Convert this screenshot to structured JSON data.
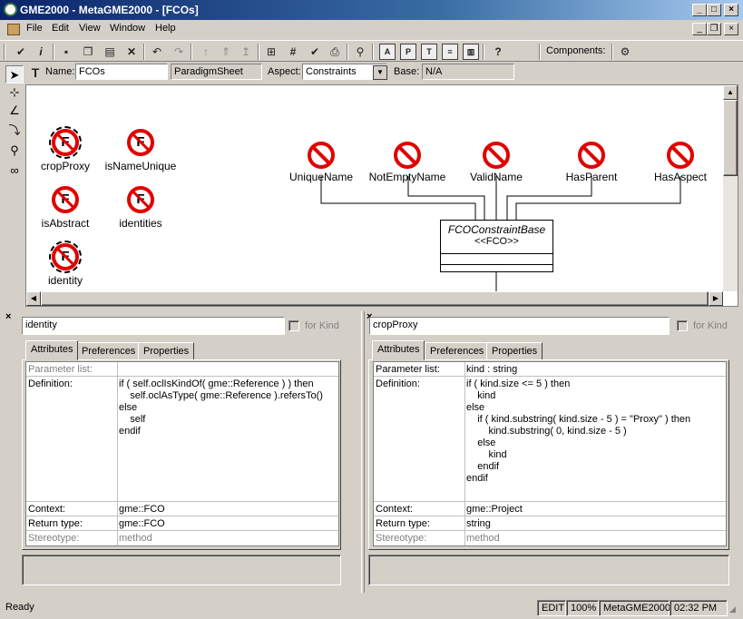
{
  "window": {
    "title": "GME2000 - MetaGME2000 - [FCOs]",
    "min": "_",
    "max": "□",
    "close": "×"
  },
  "menu": {
    "items": [
      "File",
      "Edit",
      "View",
      "Window",
      "Help"
    ]
  },
  "toolbar": {
    "components_label": "Components:"
  },
  "props": {
    "name_label": "Name:",
    "name_value": "FCOs",
    "kind_value": "ParadigmSheet",
    "aspect_label": "Aspect:",
    "aspect_value": "Constraints",
    "base_label": "Base:",
    "base_value": "N/A"
  },
  "canvas": {
    "fcos": [
      "cropProxy",
      "isNameUnique",
      "isAbstract",
      "identities",
      "identity"
    ],
    "constraints": [
      "UniqueName",
      "NotEmptyName",
      "ValidName",
      "HasParent",
      "HasAspect"
    ],
    "base_box": {
      "name": "FCOConstraintBase",
      "stereotype": "<<FCO>>"
    }
  },
  "panels": [
    {
      "name": "identity",
      "for_kind": "for Kind",
      "tabs": [
        "Attributes",
        "Preferences",
        "Properties"
      ],
      "rows": {
        "param_key": "Parameter list:",
        "param_val": "",
        "def_key": "Definition:",
        "def_val": "if ( self.oclIsKindOf( gme::Reference ) ) then\n    self.oclAsType( gme::Reference ).refersTo()\nelse\n    self\nendif",
        "ctx_key": "Context:",
        "ctx_val": "gme::FCO",
        "ret_key": "Return type:",
        "ret_val": "gme::FCO",
        "ster_key": "Stereotype:",
        "ster_val": "method"
      }
    },
    {
      "name": "cropProxy",
      "for_kind": "for Kind",
      "tabs": [
        "Attributes",
        "Preferences",
        "Properties"
      ],
      "rows": {
        "param_key": "Parameter list:",
        "param_val": "kind : string",
        "def_key": "Definition:",
        "def_val": "if ( kind.size <= 5 ) then\n    kind\nelse\n    if ( kind.substring( kind.size - 5 ) = \"Proxy\" ) then\n        kind.substring( 0, kind.size - 5 )\n    else\n        kind\n    endif\nendif",
        "ctx_key": "Context:",
        "ctx_val": "gme::Project",
        "ret_key": "Return type:",
        "ret_val": "string",
        "ster_key": "Stereotype:",
        "ster_val": "method"
      }
    }
  ],
  "status": {
    "ready": "Ready",
    "mode": "EDIT",
    "zoom": "100%",
    "paradigm": "MetaGME2000",
    "time": "02:32 PM"
  }
}
